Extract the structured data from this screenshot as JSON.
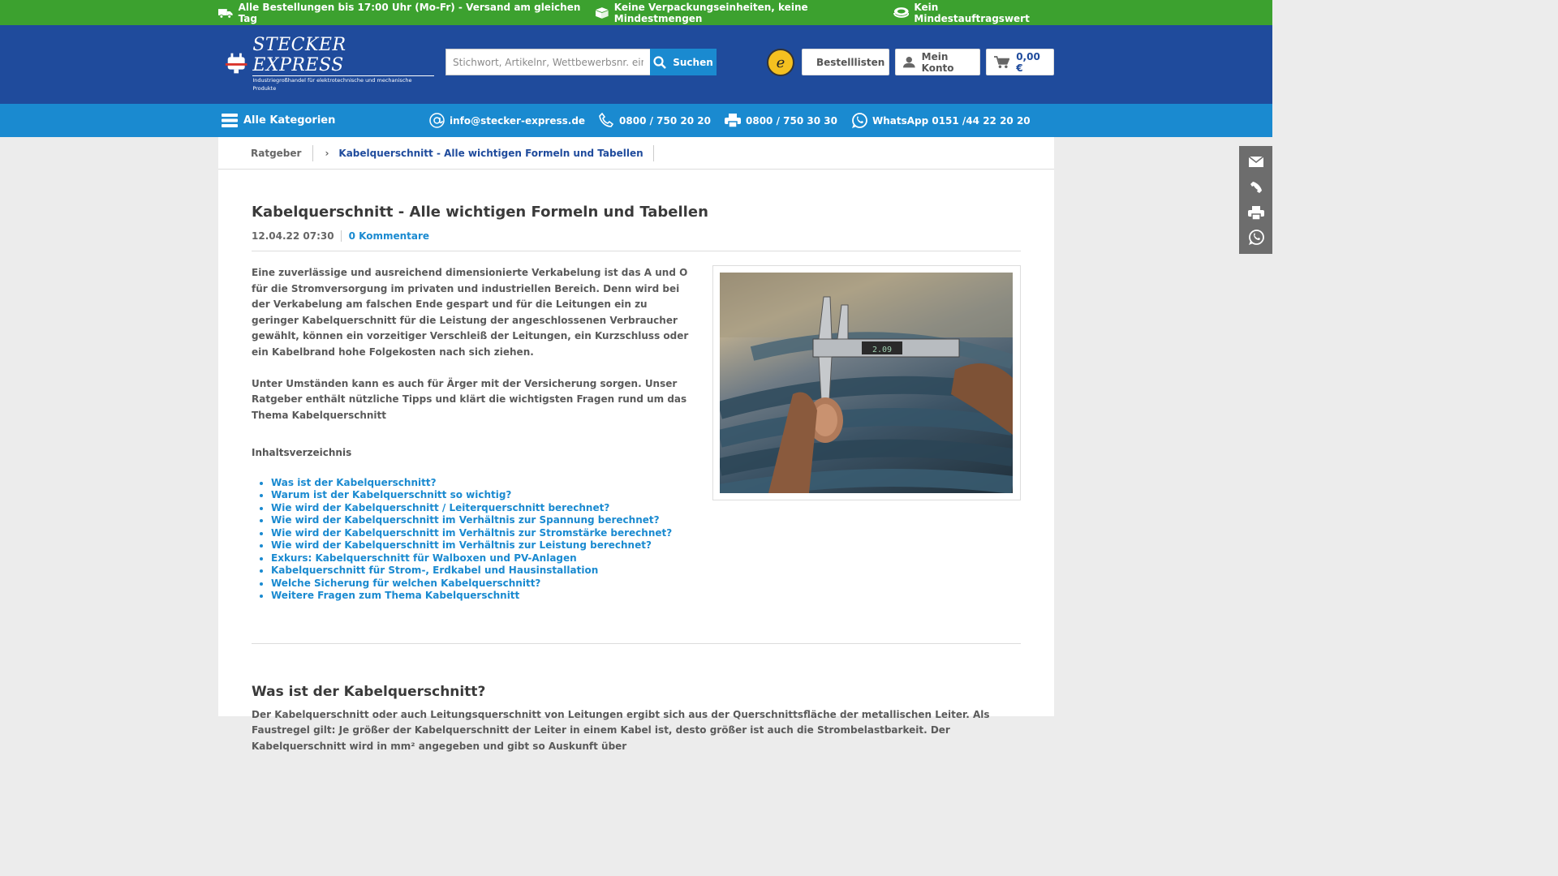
{
  "topbar": {
    "usp1": "Alle Bestellungen bis 17:00 Uhr (Mo-Fr) - Versand am gleichen Tag",
    "usp2": "Keine Verpackungseinheiten, keine Mindestmengen",
    "usp3": "Kein Mindestauftragswert"
  },
  "header": {
    "logo_main": "STECKER EXPRESS",
    "logo_sub": "Industriegroßhandel für elektrotechnische und mechanische Produkte",
    "search_placeholder": "Stichwort, Artikelnr, Wettbewerbsnr. eingeben...",
    "search_button": "Suchen",
    "trust_badge": "e",
    "lists_label": "Bestelllisten",
    "account_label": "Mein Konto",
    "cart_total": "0,00 €"
  },
  "nav": {
    "categories": "Alle Kategorien",
    "email": "info@stecker-express.de",
    "phone": "0800 / 750 20 20",
    "fax": "0800 / 750 30 30",
    "whatsapp": "WhatsApp 0151 /44 22 20 20"
  },
  "breadcrumb": {
    "root": "Ratgeber",
    "separator": "›",
    "current": "Kabelquerschnitt - Alle wichtigen Formeln und Tabellen"
  },
  "article": {
    "title": "Kabelquerschnitt - Alle wichtigen Formeln und Tabellen",
    "date": "12.04.22 07:30",
    "comments": "0 Kommentare",
    "intro_p1": "Eine zuverlässige und ausreichend dimensionierte Verkabelung ist das A und O für die Stromversorgung im privaten und industriellen Bereich. Denn wird bei der Verkabelung am falschen Ende gespart und für die Leitungen ein zu geringer Kabelquerschnitt für die Leistung der angeschlossenen Verbraucher gewählt, können ein vorzeitiger Verschleiß der Leitungen, ein Kurzschluss oder ein Kabelbrand hohe Folgekosten nach sich ziehen.",
    "intro_p2": "Unter Umständen kann es auch für Ärger mit der Versicherung sorgen. Unser Ratgeber enthält nützliche Tipps und klärt die wichtigsten Fragen rund um das Thema Kabelquerschnitt",
    "toc_heading": "Inhaltsverzeichnis",
    "toc": [
      "Was ist der Kabelquerschnitt?",
      "Warum ist der Kabelquerschnitt so wichtig?",
      "Wie wird der Kabelquerschnitt / Leiterquerschnitt berechnet?",
      "Wie wird der Kabelquerschnitt im Verhältnis zur Spannung berechnet?",
      "Wie wird der Kabelquerschnitt im Verhältnis zur Stromstärke berechnet?",
      "Wie wird der Kabelquerschnitt im Verhältnis zur Leistung berechnet?",
      "Exkurs: Kabelquerschnitt für Walboxen und PV-Anlagen",
      "Kabelquerschnitt für Strom-, Erdkabel und Hausinstallation",
      "Welche Sicherung für welchen Kabelquerschnitt?",
      "Weitere Fragen zum Thema Kabelquerschnitt"
    ],
    "section1_title": "Was ist der Kabelquerschnitt?",
    "section1_text": "Der Kabelquerschnitt oder auch Leitungsquerschnitt von Leitungen ergibt sich aus der Querschnittsfläche der metallischen Leiter. Als Faustregel gilt: Je größer der Kabelquerschnitt der Leiter in einem Kabel ist, desto größer ist auch die Strombelastbarkeit. Der Kabelquerschnitt wird in mm² angegeben und gibt so Auskunft über",
    "caliper_display": "2.09"
  },
  "icons": {
    "truck": "truck-icon",
    "box": "box-icon",
    "coins": "coins-icon",
    "search": "search-icon",
    "list": "list-icon",
    "user": "user-icon",
    "cart": "cart-icon",
    "menu": "menu-icon",
    "at": "at-icon",
    "phone": "phone-icon",
    "fax": "fax-icon",
    "whatsapp": "whatsapp-icon",
    "mail": "mail-icon"
  },
  "colors": {
    "topbar": "#3ca12f",
    "header": "#1f4b9c",
    "nav": "#1a8ad0",
    "link": "#1a8ad0",
    "sidebar": "#6d6d6d"
  }
}
